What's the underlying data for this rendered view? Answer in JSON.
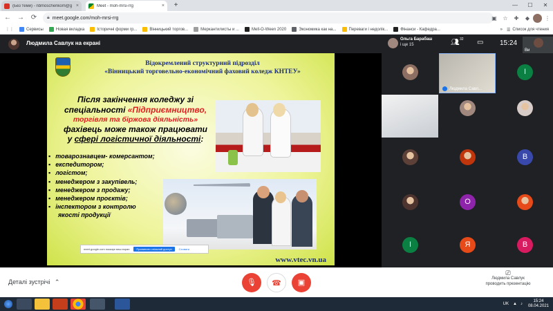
{
  "tabs": [
    {
      "label": "(Без теми) - nbmoschenkom@g",
      "close": "×"
    },
    {
      "label": "Meet - moh-mrsi-rrg",
      "close": "×"
    }
  ],
  "new_tab": "+",
  "window": {
    "minimize": "—",
    "maximize": "☐",
    "close": "✕"
  },
  "address": {
    "url": "meet.google.com/moh-mrsi-rrg"
  },
  "bookmarks": [
    {
      "label": "Сервисы",
      "color": "#4285f4"
    },
    {
      "label": "Новая вкладка",
      "color": "#34a853"
    },
    {
      "label": "Історичні форми гр...",
      "color": "#fbbc04"
    },
    {
      "label": "Вінницький торгов...",
      "color": "#fbbc04"
    },
    {
      "label": "Меркантилисты и ...",
      "color": "#9e9e9e"
    },
    {
      "label": "Mell-O-Ween 2020",
      "color": "#212121"
    },
    {
      "label": "Экономика как на...",
      "color": "#5f6368"
    },
    {
      "label": "Переваги і недолік...",
      "color": "#fbbc04"
    },
    {
      "label": "Фінанси - Кафедра...",
      "color": "#212121"
    }
  ],
  "bookmarks_more": "»",
  "reading_list": "Список для чтения",
  "meet": {
    "presenter_label": "Людмила Савлук на екрані",
    "pinned_name": "Ольга Барабаш",
    "pinned_sub": "і ще 15",
    "participants_count": "32",
    "time": "15:24",
    "you_label": "Ви"
  },
  "slide": {
    "title_line1": "Відокремлений структурний підрозділ",
    "title_line2": "«Вінницький торговельно-економічний фаховий коледж КНТЕУ»",
    "line1": "Після закінчення коледжу зі",
    "line2a": "спеціальності ",
    "line2b": "«Підприємництво,",
    "line3": "торгівля та біржова діяльність»",
    "line4": "фахівець може також працювати",
    "line5a": "у ",
    "line5b": "сфері логістичної діяльності",
    "line5c": ":",
    "bullets": [
      "товарознавцем- комерсантом;",
      "експедитором;",
      "логістом;",
      "менеджером з закупівель;",
      "менеджером з продажу;",
      "менеджером проєктів;",
      "інспектором з контролю"
    ],
    "bullet_cont": "якості продукції",
    "website": "www.vtec.vn.ua"
  },
  "sharebar": {
    "text": "meet.google.com показує ваш екран",
    "stop": "Припинити спільний доступ",
    "hide": "Сховати"
  },
  "tiles": [
    {
      "type": "photo",
      "color": "#8d6e63"
    },
    {
      "type": "self",
      "label": "Людмила Савл..."
    },
    {
      "type": "letter",
      "letter": "І",
      "color": "#0b8043"
    },
    {
      "type": "camera"
    },
    {
      "type": "photo",
      "color": "#a1887f"
    },
    {
      "type": "photo",
      "color": "#d7ccc8"
    },
    {
      "type": "photo",
      "color": "#5d4037"
    },
    {
      "type": "photo",
      "color": "#bf360c"
    },
    {
      "type": "letter",
      "letter": "В",
      "color": "#3949ab"
    },
    {
      "type": "photo",
      "color": "#4e342e"
    },
    {
      "type": "letter",
      "letter": "О",
      "color": "#8e24aa"
    },
    {
      "type": "photo",
      "color": "#e64a19"
    },
    {
      "type": "letter",
      "letter": "І",
      "color": "#0b8043"
    },
    {
      "type": "letter",
      "letter": "Я",
      "color": "#e64a19"
    },
    {
      "type": "letter",
      "letter": "В",
      "color": "#d81b60"
    }
  ],
  "bottom": {
    "details": "Деталі зустрічі",
    "presenting_line1": "Людмила Савлук",
    "presenting_line2": "проводить презентацію"
  },
  "taskbar": {
    "lang": "UK",
    "time": "15:24",
    "date": "08.04.2021"
  }
}
